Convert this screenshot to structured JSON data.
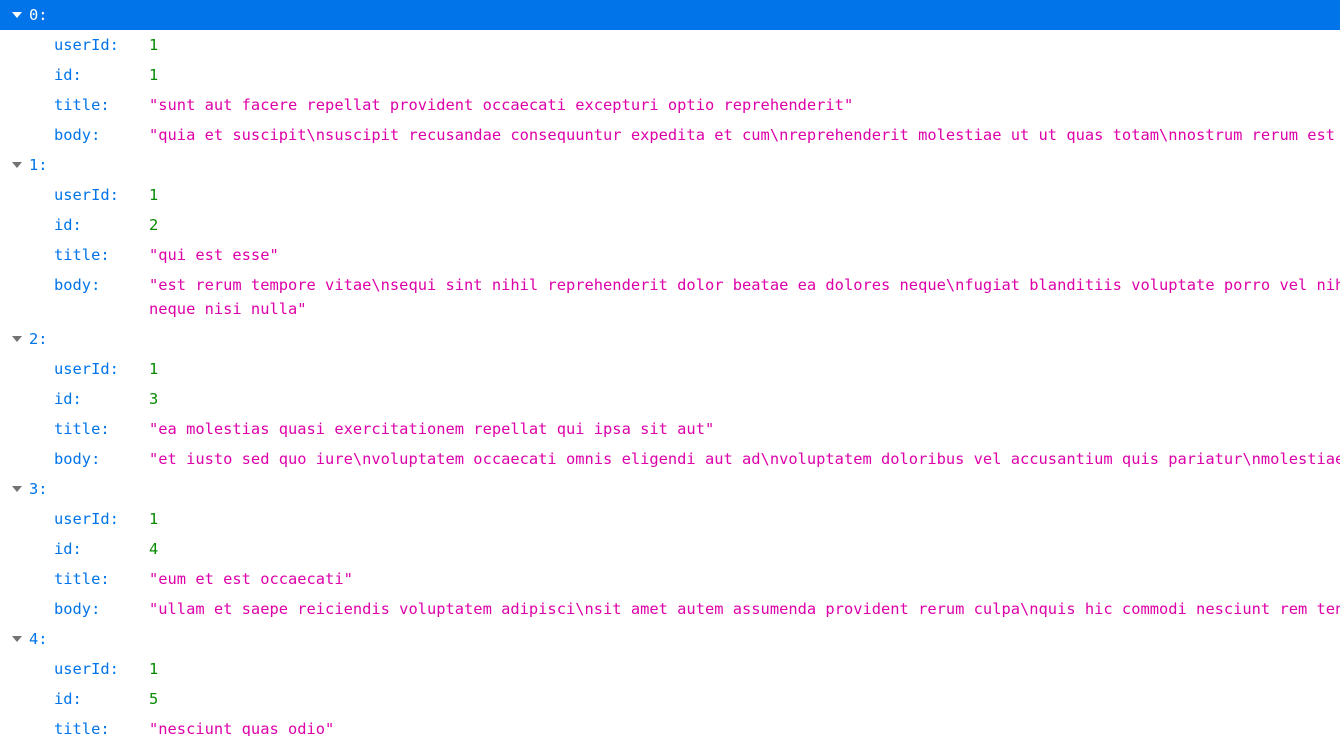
{
  "objects": [
    {
      "index_label": "0:",
      "selected": true,
      "props": [
        {
          "key": "userId:",
          "value": "1",
          "kind": "num"
        },
        {
          "key": "id:",
          "value": "1",
          "kind": "num"
        },
        {
          "key": "title:",
          "value": "\"sunt aut facere repellat provident occaecati excepturi optio reprehenderit\"",
          "kind": "str"
        },
        {
          "key": "body:",
          "value": "\"quia et suscipit\\nsuscipit recusandae consequuntur expedita et cum\\nreprehenderit molestiae ut ut quas totam\\nnostrum rerum est aut",
          "kind": "str"
        }
      ]
    },
    {
      "index_label": "1:",
      "selected": false,
      "props": [
        {
          "key": "userId:",
          "value": "1",
          "kind": "num"
        },
        {
          "key": "id:",
          "value": "2",
          "kind": "num"
        },
        {
          "key": "title:",
          "value": "\"qui est esse\"",
          "kind": "str"
        },
        {
          "key": "body:",
          "value": "\"est rerum tempore vitae\\nsequi sint nihil reprehenderit dolor beatae ea dolores neque\\nfugiat blanditiis voluptate porro vel nihil molestiae ut reiciendis\\nqui aperiam non debitis possimus qui neque nisi nulla\"",
          "kind": "str",
          "display": "\"est rerum tempore vitae\\nsequi sint nihil reprehenderit dolor beatae ea dolores neque\\nfugiat blanditiis voluptate porro vel nihil",
          "display2": "neque nisi nulla\""
        }
      ]
    },
    {
      "index_label": "2:",
      "selected": false,
      "props": [
        {
          "key": "userId:",
          "value": "1",
          "kind": "num"
        },
        {
          "key": "id:",
          "value": "3",
          "kind": "num"
        },
        {
          "key": "title:",
          "value": "\"ea molestias quasi exercitationem repellat qui ipsa sit aut\"",
          "kind": "str"
        },
        {
          "key": "body:",
          "value": "\"et iusto sed quo iure\\nvoluptatem occaecati omnis eligendi aut ad\\nvoluptatem doloribus vel accusantium quis pariatur\\nmolestiae po",
          "kind": "str"
        }
      ]
    },
    {
      "index_label": "3:",
      "selected": false,
      "props": [
        {
          "key": "userId:",
          "value": "1",
          "kind": "num"
        },
        {
          "key": "id:",
          "value": "4",
          "kind": "num"
        },
        {
          "key": "title:",
          "value": "\"eum et est occaecati\"",
          "kind": "str"
        },
        {
          "key": "body:",
          "value": "\"ullam et saepe reiciendis voluptatem adipisci\\nsit amet autem assumenda provident rerum culpa\\nquis hic commodi nesciunt rem tenetu",
          "kind": "str"
        }
      ]
    },
    {
      "index_label": "4:",
      "selected": false,
      "props": [
        {
          "key": "userId:",
          "value": "1",
          "kind": "num"
        },
        {
          "key": "id:",
          "value": "5",
          "kind": "num"
        },
        {
          "key": "title:",
          "value": "\"nesciunt quas odio\"",
          "kind": "str"
        }
      ]
    }
  ],
  "colors": {
    "selected_bg": "#0074e8",
    "key": "#0074e8",
    "number": "#058b00",
    "string": "#dd00a9",
    "twisty": "#737373"
  }
}
